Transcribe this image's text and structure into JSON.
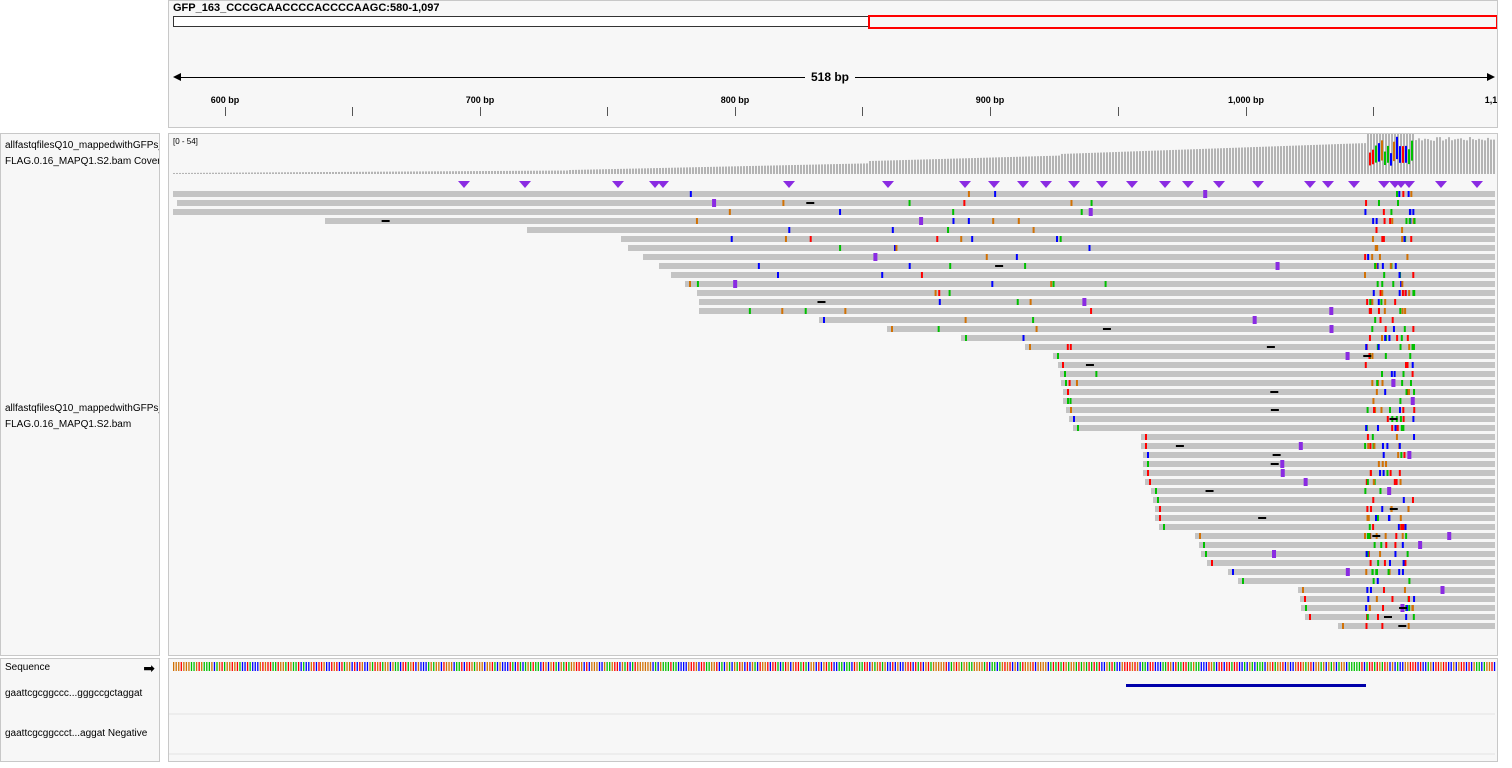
{
  "locus": {
    "title": "GFP_163_CCCGCAACCCCACCCCAAGC:580-1,097",
    "span_label": "518 bp",
    "start": 580,
    "end": 1097,
    "ticks": [
      "600 bp",
      "700 bp",
      "800 bp",
      "900 bp",
      "1,000 bp",
      "1,1"
    ]
  },
  "tracks": {
    "coverage": {
      "name_line1": "allfastqfilesQ10_mappedwithGFPs_",
      "name_line2": "FLAG.0.16_MAPQ1.S2.bam Covera",
      "range": "[0 - 54]"
    },
    "alignments": {
      "name_line1": "allfastqfilesQ10_mappedwithGFPs_",
      "name_line2": "FLAG.0.16_MAPQ1.S2.bam"
    },
    "sequence": {
      "name": "Sequence",
      "arrow_icon": "arrow-right-icon"
    },
    "features": [
      {
        "name": "gaattcgcggccc...gggccgctaggat"
      },
      {
        "name": "gaattcgcggccct...aggat Negative"
      }
    ]
  },
  "colors": {
    "read": "#c4c4c4",
    "coverage": "#b4b4b4",
    "base_A": "#00c000",
    "base_C": "#0000ff",
    "base_G": "#d17105",
    "base_T": "#ff0000",
    "insertion": "#8a2be2",
    "feature": "#0000aa",
    "viewport": "#ff0000"
  }
}
